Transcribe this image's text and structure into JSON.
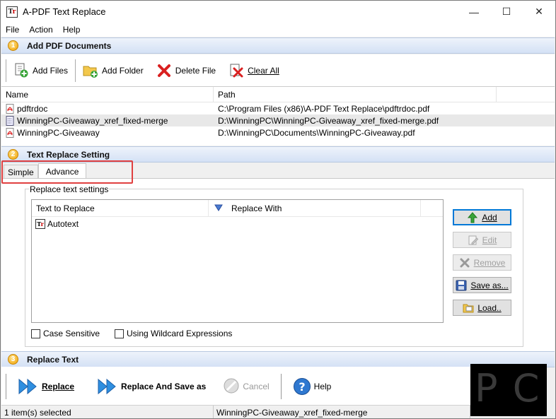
{
  "window": {
    "title": "A-PDF Text Replace",
    "controls": {
      "minimize": "—",
      "maximize": "☐",
      "close": "✕"
    }
  },
  "menu": [
    "File",
    "Action",
    "Help"
  ],
  "section1": {
    "number": "1",
    "title": "Add PDF Documents"
  },
  "toolbar1": {
    "add_files": "Add Files",
    "add_folder": "Add Folder",
    "delete_file": "Delete File",
    "clear_all": "Clear All"
  },
  "file_list": {
    "columns": [
      "Name",
      "Path"
    ],
    "rows": [
      {
        "name": "pdftrdoc",
        "path": "C:\\Program Files (x86)\\A-PDF Text Replace\\pdftrdoc.pdf"
      },
      {
        "name": "WinningPC-Giveaway_xref_fixed-merge",
        "path": "D:\\WinningPC\\WinningPC-Giveaway_xref_fixed-merge.pdf"
      },
      {
        "name": "WinningPC-Giveaway",
        "path": "D:\\WinningPC\\Documents\\WinningPC-Giveaway.pdf"
      }
    ]
  },
  "section2": {
    "number": "2",
    "title": "Text Replace Setting"
  },
  "tabs": [
    "Simple",
    "Advance"
  ],
  "replace_settings": {
    "group_label": "Replace text settings",
    "columns": [
      "Text to Replace",
      "Replace With"
    ],
    "rows": [
      {
        "text": "Autotext",
        "replace": ""
      }
    ],
    "buttons": {
      "add": "Add",
      "edit": "Edit",
      "remove": "Remove",
      "save_as": "Save as...",
      "load": "Load.."
    },
    "case_sensitive": "Case Sensitive",
    "wildcard": "Using Wildcard Expressions"
  },
  "section3": {
    "number": "3",
    "title": "Replace Text"
  },
  "toolbar3": {
    "replace": "Replace",
    "replace_save": "Replace And Save as",
    "cancel": "Cancel",
    "help": "Help"
  },
  "status": {
    "selected": "1 item(s) selected",
    "current": "WinningPC-Giveaway_xref_fixed-merge"
  },
  "watermark": "P C"
}
